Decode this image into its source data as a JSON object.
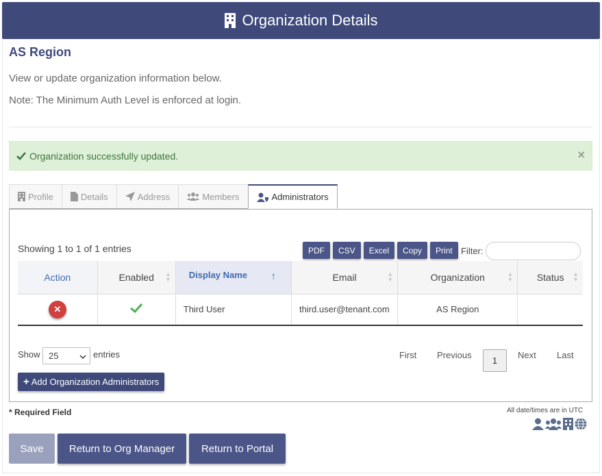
{
  "header": {
    "title": "Organization Details",
    "icon": "building-icon"
  },
  "org": {
    "name": "AS Region",
    "description": "View or update organization information below.",
    "note": "Note: The Minimum Auth Level is enforced at login."
  },
  "alert": {
    "message": "Organization successfully updated.",
    "close": "×"
  },
  "tabs": [
    {
      "label": "Profile",
      "icon": "building-icon"
    },
    {
      "label": "Details",
      "icon": "file-icon"
    },
    {
      "label": "Address",
      "icon": "location-arrow-icon"
    },
    {
      "label": "Members",
      "icon": "users-icon"
    },
    {
      "label": "Administrators",
      "icon": "user-shield-icon",
      "active": true
    }
  ],
  "table_info": {
    "showing": "Showing 1 to 1 of 1 entries",
    "export_buttons": [
      "PDF",
      "CSV",
      "Excel",
      "Copy",
      "Print"
    ],
    "filter_label": "Filter:"
  },
  "table": {
    "columns": [
      "Action",
      "Enabled",
      "Display Name",
      "Email",
      "Organization",
      "Status"
    ],
    "rows": [
      {
        "display_name": "Third User",
        "email": "third.user@tenant.com",
        "organization": "AS Region",
        "status": ""
      }
    ]
  },
  "length": {
    "show": "Show",
    "value": "25",
    "entries": "entries"
  },
  "pager": {
    "first": "First",
    "previous": "Previous",
    "current": "1",
    "next": "Next",
    "last": "Last"
  },
  "add_button": "Add Organization Administrators",
  "required_note": "* Required Field",
  "utc_note": "All date/times are in UTC",
  "footer": {
    "save": "Save",
    "return_org": "Return to Org Manager",
    "return_portal": "Return to Portal"
  },
  "colors": {
    "primary": "#3f4a7b",
    "success_bg": "#dff0d8",
    "danger": "#d04040"
  }
}
